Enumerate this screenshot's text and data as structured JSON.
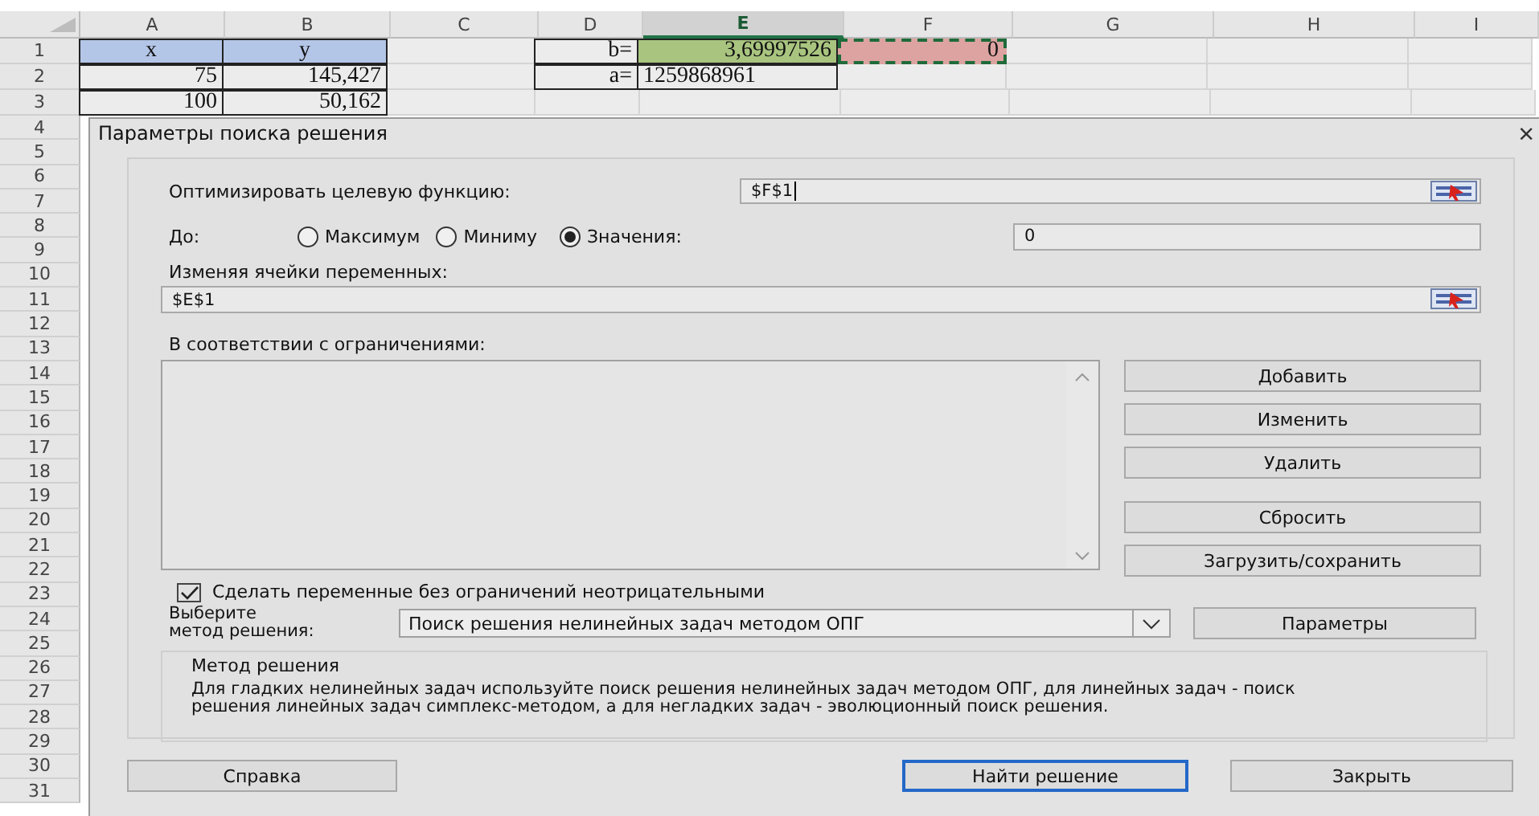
{
  "sheet": {
    "columns": [
      {
        "label": "A",
        "selected": false
      },
      {
        "label": "B",
        "selected": false
      },
      {
        "label": "C",
        "selected": false
      },
      {
        "label": "D",
        "selected": false
      },
      {
        "label": "E",
        "selected": true
      },
      {
        "label": "F",
        "selected": false
      },
      {
        "label": "G",
        "selected": false
      },
      {
        "label": "H",
        "selected": false
      },
      {
        "label": "I",
        "selected": false
      }
    ],
    "rows": [
      {
        "number": "1",
        "cells": [
          {
            "text": "x",
            "color": "#b4c6e7",
            "bordered": true,
            "kind": "header"
          },
          {
            "text": "y",
            "color": "#b4c6e7",
            "bordered": true,
            "kind": "header"
          },
          {},
          {
            "text": "b=",
            "bordered": true,
            "kind": "number"
          },
          {
            "text": "3,69997526",
            "color": "#a9c47f",
            "bordered": true,
            "kind": "number"
          },
          {
            "text": "0",
            "color": "#dca3a0",
            "marquee": true,
            "kind": "number"
          },
          {},
          {},
          {}
        ]
      },
      {
        "number": "2",
        "cells": [
          {
            "text": "75",
            "bordered": true,
            "kind": "number"
          },
          {
            "text": "145,427",
            "bordered": true,
            "kind": "number"
          },
          {},
          {
            "text": "a=",
            "bordered": true,
            "kind": "number"
          },
          {
            "text": "1259868961",
            "bordered": true,
            "kind": "text"
          },
          {},
          {},
          {},
          {}
        ]
      },
      {
        "number": "3",
        "cells": [
          {
            "text": "100",
            "bordered": true,
            "kind": "number"
          },
          {
            "text": "50,162",
            "bordered": true,
            "kind": "number"
          },
          {},
          {},
          {},
          {},
          {},
          {},
          {}
        ]
      }
    ],
    "hidden_row_numbers": [
      "4",
      "5",
      "6",
      "7",
      "8",
      "9",
      "10",
      "11",
      "12",
      "13",
      "14",
      "15",
      "16",
      "17",
      "18",
      "19",
      "20",
      "21",
      "22",
      "23",
      "24",
      "25",
      "26",
      "27",
      "28",
      "29",
      "30",
      "31"
    ]
  },
  "dialog": {
    "title": "Параметры поиска решения",
    "close": "×",
    "objective": {
      "label": "Оптимизировать целевую функцию:",
      "value": "$F$1"
    },
    "to": {
      "label": "До:",
      "options": [
        {
          "label": "Максимум",
          "selected": false
        },
        {
          "label": "Миниму",
          "selected": false
        },
        {
          "label": "Значения:",
          "selected": true
        }
      ],
      "value": "0"
    },
    "variables": {
      "label": "Изменяя ячейки переменных:",
      "value": "$E$1"
    },
    "constraints": {
      "label": "В соответствии с ограничениями:",
      "buttons": [
        "Добавить",
        "Изменить",
        "Удалить",
        "Сбросить",
        "Загрузить/сохранить"
      ]
    },
    "nonnegative": {
      "label": "Сделать переменные без ограничений неотрицательными",
      "checked": true
    },
    "method": {
      "label_lines": [
        "Выберите",
        "метод решения:"
      ],
      "value": "Поиск решения нелинейных задач методом ОПГ",
      "button": "Параметры"
    },
    "description": {
      "title": "Метод решения",
      "text": "Для гладких нелинейных задач используйте поиск решения нелинейных задач методом ОПГ, для линейных задач - поиск решения линейных задач симплекс-методом, а для негладких задач - эволюционный поиск решения."
    },
    "footer": [
      {
        "label": "Справка",
        "default": false
      },
      {
        "label": "Найти решение",
        "default": true
      },
      {
        "label": "Закрыть",
        "default": false
      }
    ]
  }
}
